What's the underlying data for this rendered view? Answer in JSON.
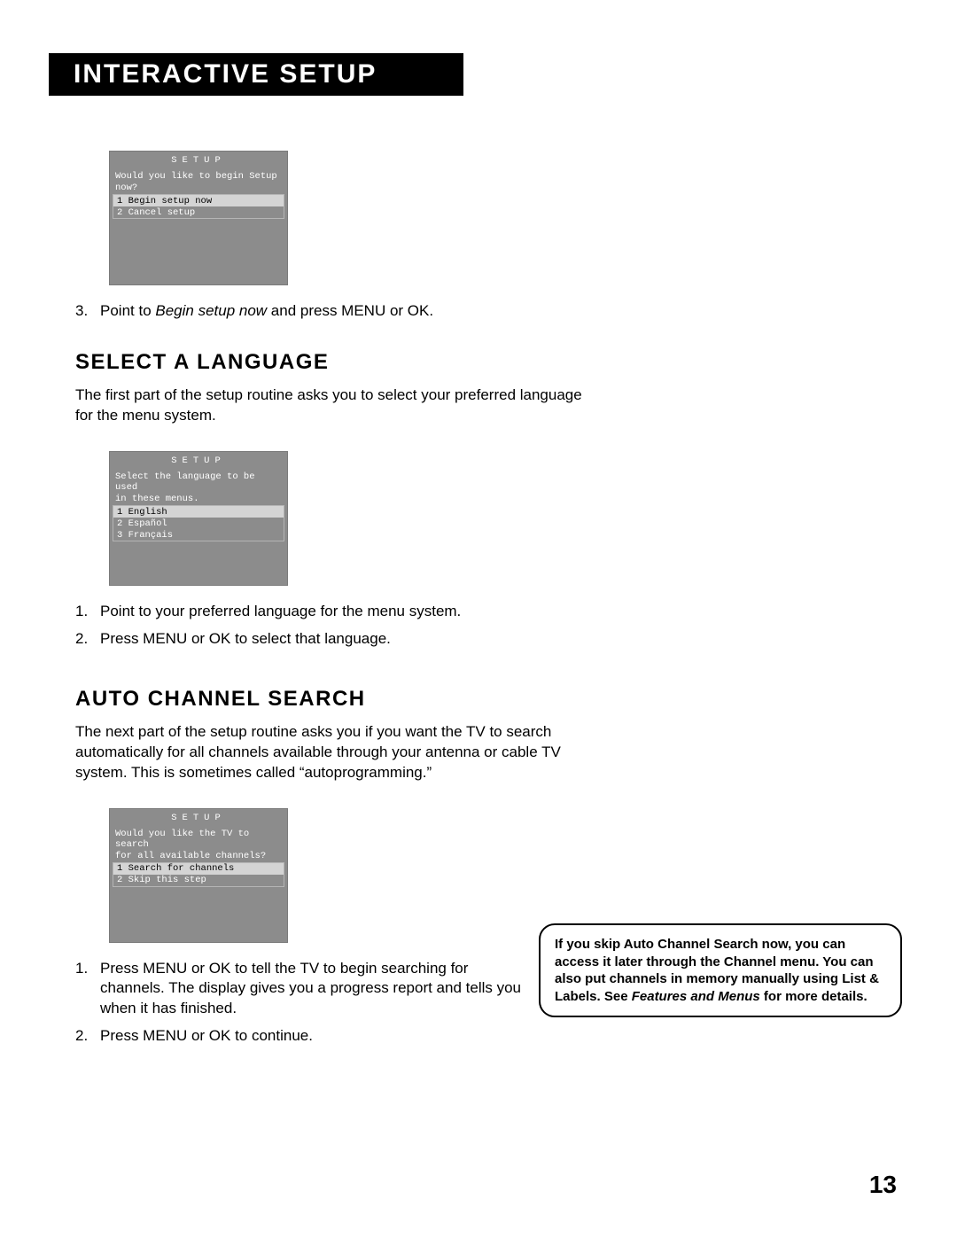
{
  "title_bar": "INTERACTIVE SETUP",
  "osd1": {
    "title": "SETUP",
    "prompt_l1": "Would you like to begin Setup",
    "prompt_l2": "now?",
    "opt1": "1 Begin setup now",
    "opt2": "2 Cancel setup"
  },
  "instr3_num": "3.",
  "instr3_a": "Point to ",
  "instr3_b": "Begin setup now",
  "instr3_c": " and press MENU or OK.",
  "sec1_heading": "SELECT A LANGUAGE",
  "sec1_body": "The first part of the setup routine asks you to select your preferred language for the menu system.",
  "osd2": {
    "title": "SETUP",
    "prompt_l1": "Select the language to be used",
    "prompt_l2": "in these menus.",
    "opt1": "1 English",
    "opt2": "2 Español",
    "opt3": "3 Français"
  },
  "sec1_step1_num": "1.",
  "sec1_step1": "Point to your preferred language for the menu system.",
  "sec1_step2_num": "2.",
  "sec1_step2": "Press MENU or OK to select that language.",
  "sec2_heading": "AUTO CHANNEL SEARCH",
  "sec2_body": "The next part of the setup routine asks you if you want the TV to search automatically for all channels available through your antenna or cable TV system. This is sometimes called “autoprogramming.”",
  "osd3": {
    "title": "SETUP",
    "prompt_l1": "Would you like the TV to search",
    "prompt_l2": "for all available channels?",
    "opt1": "1 Search for channels",
    "opt2": "2 Skip this step"
  },
  "sec2_step1_num": "1.",
  "sec2_step1": "Press MENU or OK to tell the TV to begin searching for channels. The display gives you a progress report and tells you when it has finished.",
  "sec2_step2_num": "2.",
  "sec2_step2": "Press MENU or OK to continue.",
  "sidebox_a": "If you skip Auto Channel Search now, you can access it later through the Channel menu. You can also put channels in memory manually using List & Labels. See ",
  "sidebox_b": "Features and Menus",
  "sidebox_c": " for more details.",
  "page_number": "13"
}
